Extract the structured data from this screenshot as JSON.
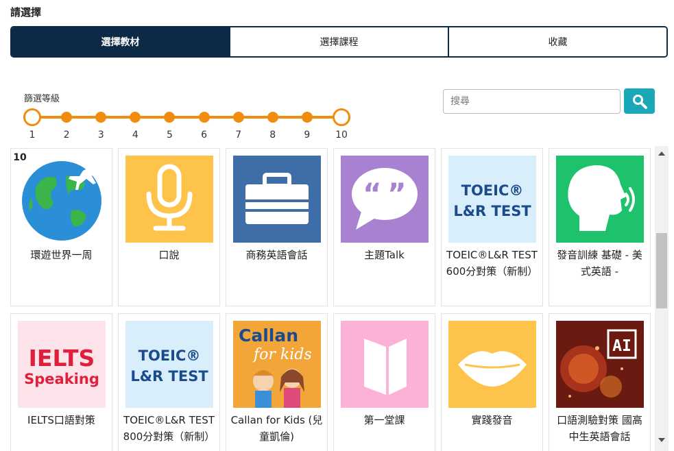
{
  "page": {
    "heading": "請選擇"
  },
  "tabs": [
    {
      "label": "選擇教材",
      "active": true
    },
    {
      "label": "選擇課程",
      "active": false
    },
    {
      "label": "收藏",
      "active": false
    }
  ],
  "filter": {
    "label": "篩選等級",
    "levels": [
      "1",
      "2",
      "3",
      "4",
      "5",
      "6",
      "7",
      "8",
      "9",
      "10"
    ],
    "range_min": 1,
    "range_max": 10,
    "accent_color": "#f28c0f"
  },
  "search": {
    "placeholder": "搜尋",
    "button_icon": "search-icon",
    "button_color": "#1aa8b8"
  },
  "cards": [
    {
      "title": "環遊世界一周",
      "badge": "10",
      "thumb": "globe-airplane",
      "bg": "#2fa5d8"
    },
    {
      "title": "口說",
      "thumb": "microphone",
      "bg": "#fdc34a"
    },
    {
      "title": "商務英語會話",
      "thumb": "briefcase",
      "bg": "#3f6da8"
    },
    {
      "title": "主題Talk",
      "thumb": "speech-bubble-quotes",
      "bg": "#a882d1"
    },
    {
      "title": "TOEIC®L&R TEST 600分對策（新制）",
      "thumb": "toeic-logo",
      "bg": "#d9eefb",
      "thumb_text": [
        "TOEIC®",
        "L&R TEST"
      ]
    },
    {
      "title": "發音訓練 基礎 - 美式英語 -",
      "thumb": "speaking-head",
      "bg": "#1fc26c"
    },
    {
      "title": "IELTS口語對策",
      "thumb": "ielts-logo",
      "bg": "#fde4ea",
      "thumb_text": [
        "IELTS",
        "Speaking"
      ]
    },
    {
      "title": "TOEIC®L&R TEST 800分對策（新制）",
      "thumb": "toeic-logo",
      "bg": "#d9eefb",
      "thumb_text": [
        "TOEIC®",
        "L&R TEST"
      ]
    },
    {
      "title": "Callan for Kids (兒童凱倫)",
      "thumb": "callan-kids",
      "bg": "#f2a63a",
      "thumb_text": [
        "Callan",
        "for kids"
      ]
    },
    {
      "title": "第一堂課",
      "thumb": "open-book",
      "bg": "#fcb2d6"
    },
    {
      "title": "實踐發音",
      "thumb": "lips",
      "bg": "#fdc34a"
    },
    {
      "title": "口語測驗對策 國高中生英語會話",
      "thumb": "ai-face",
      "bg": "#6a1a10",
      "thumb_text": [
        "AI"
      ]
    }
  ]
}
